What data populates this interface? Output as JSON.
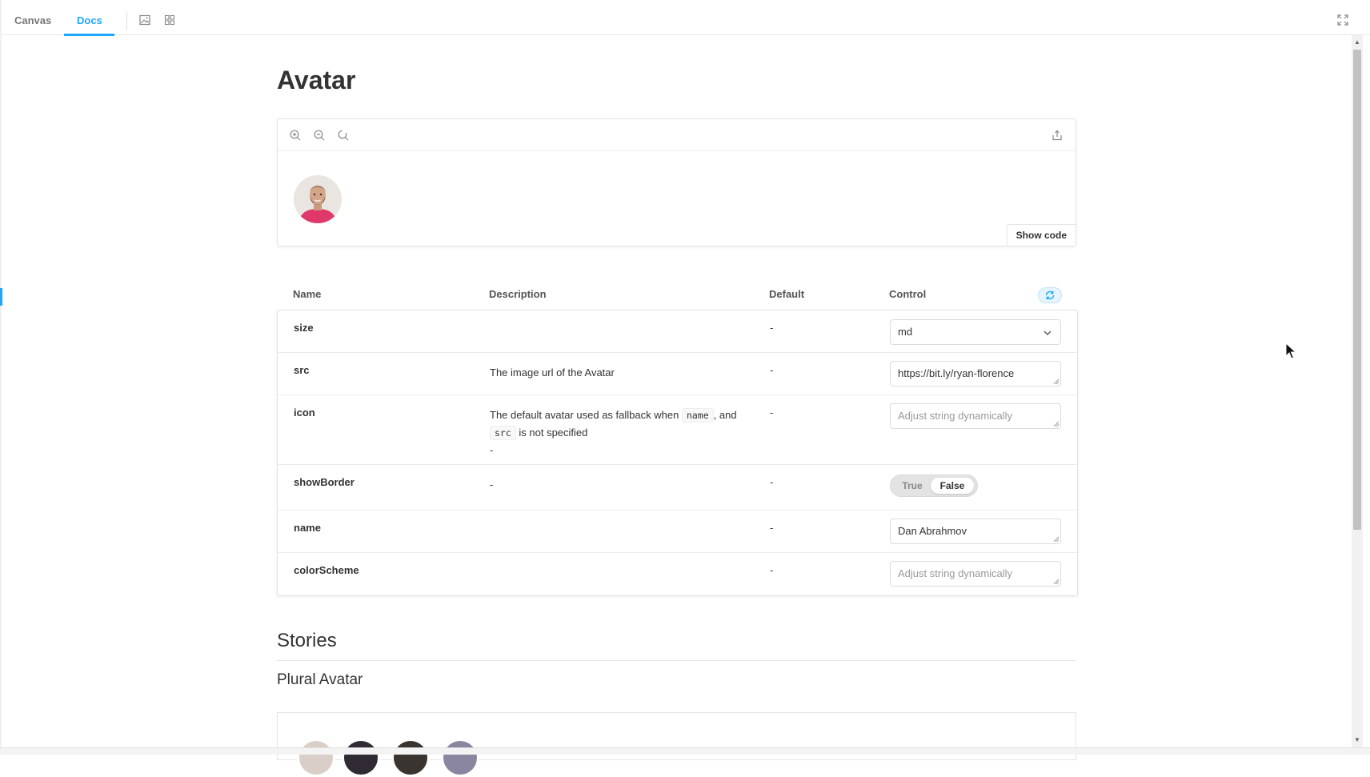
{
  "toolbar": {
    "tabs": [
      {
        "label": "Canvas",
        "active": false
      },
      {
        "label": "Docs",
        "active": true
      }
    ],
    "icons": [
      "image-icon",
      "grid-icon",
      "fullscreen-icon"
    ],
    "accent_color": "#1ea7fd"
  },
  "docs": {
    "title": "Avatar",
    "preview": {
      "toolbar_icons": [
        "zoom-in-icon",
        "zoom-out-icon",
        "zoom-reset-icon",
        "share-icon"
      ],
      "show_code_label": "Show code"
    },
    "props_table": {
      "headers": {
        "name": "Name",
        "description": "Description",
        "default": "Default",
        "control": "Control"
      },
      "rows": [
        {
          "name": "size",
          "description": "",
          "default": "-",
          "control_type": "select",
          "control_value": "md"
        },
        {
          "name": "src",
          "description": "The image url of the Avatar",
          "default": "-",
          "control_type": "text",
          "control_value": "https://bit.ly/ryan-florence"
        },
        {
          "name": "icon",
          "description_parts": [
            "The default avatar used as fallback when ",
            "name",
            ", and ",
            "src",
            " is not specified"
          ],
          "description_extra": "-",
          "default": "-",
          "control_type": "text",
          "control_placeholder": "Adjust string dynamically"
        },
        {
          "name": "showBorder",
          "description": "-",
          "default": "-",
          "control_type": "toggle",
          "toggle_true": "True",
          "toggle_false": "False",
          "selected": "False"
        },
        {
          "name": "name",
          "description": "",
          "default": "-",
          "control_type": "text",
          "control_value": "Dan Abrahmov"
        },
        {
          "name": "colorScheme",
          "description": "",
          "default": "-",
          "control_type": "text",
          "control_placeholder": "Adjust string dynamically"
        }
      ]
    },
    "stories": {
      "heading": "Stories",
      "first_story_title": "Plural Avatar"
    }
  }
}
